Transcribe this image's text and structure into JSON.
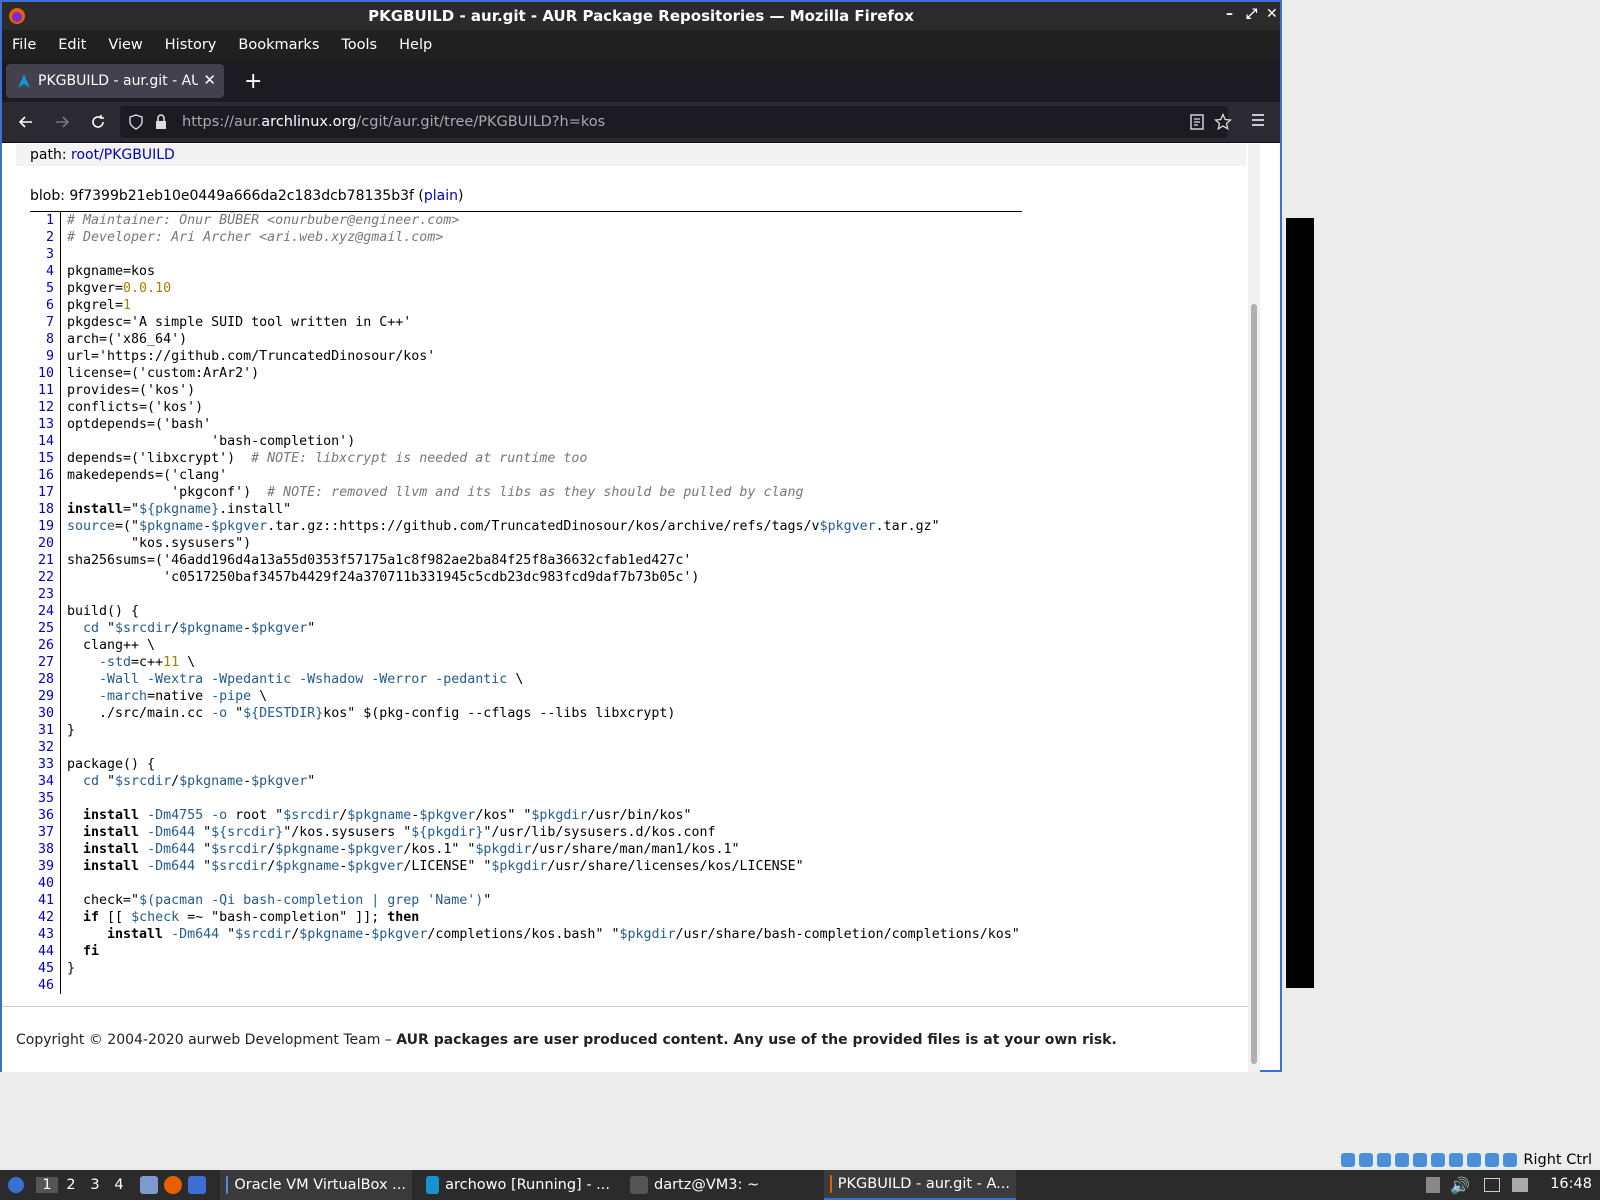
{
  "window": {
    "title": "PKGBUILD - aur.git - AUR Package Repositories — Mozilla Firefox",
    "controls": [
      "–",
      "⤢",
      "✕"
    ]
  },
  "menu": [
    "File",
    "Edit",
    "View",
    "History",
    "Bookmarks",
    "Tools",
    "Help"
  ],
  "tab": {
    "title": "PKGBUILD - aur.git - AUR",
    "close": "✕",
    "newtab": "+"
  },
  "url": {
    "prefix": "https://aur.",
    "domain": "archlinux.org",
    "suffix": "/cgit/aur.git/tree/PKGBUILD?h=kos"
  },
  "page": {
    "path_label": "path: ",
    "path_link": "root/PKGBUILD",
    "blob_label": "blob: 9f7399b21eb10e0449a666da2c183dcb78135b3f (",
    "blob_link": "plain",
    "blob_close": ")",
    "footer_normal": "Copyright © 2004-2020 aurweb Development Team – ",
    "footer_bold": "AUR packages are user produced content. Any use of the provided files is at your own risk."
  },
  "code": [
    [
      [
        "cm",
        "# Maintainer: Onur BÜBER <onurbuber@engineer.com>"
      ]
    ],
    [
      [
        "cm",
        "# Developer: Ari Archer <ari.web.xyz@gmail.com>"
      ]
    ],
    [],
    [
      [
        "",
        "pkgname=kos"
      ]
    ],
    [
      [
        "",
        "pkgver="
      ],
      [
        "nm",
        "0.0.10"
      ]
    ],
    [
      [
        "",
        "pkgrel="
      ],
      [
        "nm",
        "1"
      ]
    ],
    [
      [
        "",
        "pkgdesc='A simple SUID tool written in C++'"
      ]
    ],
    [
      [
        "",
        "arch=('x86_64')"
      ]
    ],
    [
      [
        "",
        "url='https://github.com/TruncatedDinosour/kos'"
      ]
    ],
    [
      [
        "",
        "license=('custom:ArAr2')"
      ]
    ],
    [
      [
        "",
        "provides=('kos')"
      ]
    ],
    [
      [
        "",
        "conflicts=('kos')"
      ]
    ],
    [
      [
        "",
        "optdepends=('bash'"
      ]
    ],
    [
      [
        "",
        "                  'bash-completion')"
      ]
    ],
    [
      [
        "",
        "depends=('libxcrypt')  "
      ],
      [
        "cm",
        "# NOTE: libxcrypt is needed at runtime too"
      ]
    ],
    [
      [
        "",
        "makedepends=('clang'"
      ]
    ],
    [
      [
        "",
        "             'pkgconf')  "
      ],
      [
        "cm",
        "# NOTE: removed llvm and its libs as they should be pulled by clang"
      ]
    ],
    [
      [
        "kw",
        "install"
      ],
      [
        "",
        "=\""
      ],
      [
        "vr",
        "${pkgname}"
      ],
      [
        "",
        ".install\""
      ]
    ],
    [
      [
        "vr",
        "source"
      ],
      [
        "",
        "=(\""
      ],
      [
        "vr",
        "$pkgname"
      ],
      [
        "",
        "-"
      ],
      [
        "vr",
        "$pkgver"
      ],
      [
        "",
        ".tar.gz::https://github.com/TruncatedDinosour/kos/archive/refs/tags/v"
      ],
      [
        "vr",
        "$pkgver"
      ],
      [
        "",
        ".tar.gz\""
      ]
    ],
    [
      [
        "",
        "        \"kos.sysusers\")"
      ]
    ],
    [
      [
        "",
        "sha256sums=('46add196d4a13a55d0353f57175a1c8f982ae2ba84f25f8a36632cfab1ed427c'"
      ]
    ],
    [
      [
        "",
        "            'c0517250baf3457b4429f24a370711b331945c5cdb23dc983fcd9daf7b73b05c')"
      ]
    ],
    [],
    [
      [
        "",
        "build() {"
      ]
    ],
    [
      [
        "vr",
        "  cd"
      ],
      [
        "",
        " \""
      ],
      [
        "vr",
        "$srcdir"
      ],
      [
        "",
        "/"
      ],
      [
        "vr",
        "$pkgname"
      ],
      [
        "",
        "-"
      ],
      [
        "vr",
        "$pkgver"
      ],
      [
        "",
        "\""
      ]
    ],
    [
      [
        "",
        "  clang++ \\"
      ]
    ],
    [
      [
        "vr",
        "    -std"
      ],
      [
        "",
        "=c++"
      ],
      [
        "nm",
        "11"
      ],
      [
        "",
        " \\"
      ]
    ],
    [
      [
        "vr",
        "    -Wall -Wextra -Wpedantic -Wshadow -Werror -pedantic"
      ],
      [
        "",
        " \\"
      ]
    ],
    [
      [
        "vr",
        "    -march"
      ],
      [
        "",
        "=native "
      ],
      [
        "vr",
        "-pipe"
      ],
      [
        "",
        " \\"
      ]
    ],
    [
      [
        "",
        "    ./src/main.cc "
      ],
      [
        "vr",
        "-o"
      ],
      [
        "",
        " \""
      ],
      [
        "vr",
        "${DESTDIR}"
      ],
      [
        "",
        "kos\" $(pkg-config --cflags --libs libxcrypt)"
      ]
    ],
    [
      [
        "",
        "}"
      ]
    ],
    [],
    [
      [
        "",
        "package() {"
      ]
    ],
    [
      [
        "vr",
        "  cd"
      ],
      [
        "",
        " \""
      ],
      [
        "vr",
        "$srcdir"
      ],
      [
        "",
        "/"
      ],
      [
        "vr",
        "$pkgname"
      ],
      [
        "",
        "-"
      ],
      [
        "vr",
        "$pkgver"
      ],
      [
        "",
        "\""
      ]
    ],
    [],
    [
      [
        "kw",
        "  install"
      ],
      [
        "",
        " "
      ],
      [
        "vr",
        "-Dm4755 -o"
      ],
      [
        "",
        " root \""
      ],
      [
        "vr",
        "$srcdir"
      ],
      [
        "",
        "/"
      ],
      [
        "vr",
        "$pkgname"
      ],
      [
        "",
        "-"
      ],
      [
        "vr",
        "$pkgver"
      ],
      [
        "",
        "/kos\" \""
      ],
      [
        "vr",
        "$pkgdir"
      ],
      [
        "",
        "/usr/bin/kos\""
      ]
    ],
    [
      [
        "kw",
        "  install"
      ],
      [
        "",
        " "
      ],
      [
        "vr",
        "-Dm644"
      ],
      [
        "",
        " \""
      ],
      [
        "vr",
        "${srcdir}"
      ],
      [
        "",
        "\"/kos.sysusers \""
      ],
      [
        "vr",
        "${pkgdir}"
      ],
      [
        "",
        "\"/usr/lib/sysusers.d/kos.conf"
      ]
    ],
    [
      [
        "kw",
        "  install"
      ],
      [
        "",
        " "
      ],
      [
        "vr",
        "-Dm644"
      ],
      [
        "",
        " \""
      ],
      [
        "vr",
        "$srcdir"
      ],
      [
        "",
        "/"
      ],
      [
        "vr",
        "$pkgname"
      ],
      [
        "",
        "-"
      ],
      [
        "vr",
        "$pkgver"
      ],
      [
        "",
        "/kos.1\" \""
      ],
      [
        "vr",
        "$pkgdir"
      ],
      [
        "",
        "/usr/share/man/man1/kos.1\""
      ]
    ],
    [
      [
        "kw",
        "  install"
      ],
      [
        "",
        " "
      ],
      [
        "vr",
        "-Dm644"
      ],
      [
        "",
        " \""
      ],
      [
        "vr",
        "$srcdir"
      ],
      [
        "",
        "/"
      ],
      [
        "vr",
        "$pkgname"
      ],
      [
        "",
        "-"
      ],
      [
        "vr",
        "$pkgver"
      ],
      [
        "",
        "/LICENSE\" \""
      ],
      [
        "vr",
        "$pkgdir"
      ],
      [
        "",
        "/usr/share/licenses/kos/LICENSE\""
      ]
    ],
    [],
    [
      [
        "",
        "  check=\""
      ],
      [
        "vr",
        "$(pacman -Qi bash-completion | grep 'Name')"
      ],
      [
        "",
        "\""
      ]
    ],
    [
      [
        "kw",
        "  if"
      ],
      [
        "",
        " [[ "
      ],
      [
        "vr",
        "$check"
      ],
      [
        "",
        " =~ \"bash-completion\" ]]; "
      ],
      [
        "kw",
        "then"
      ]
    ],
    [
      [
        "kw",
        "     install"
      ],
      [
        "",
        " "
      ],
      [
        "vr",
        "-Dm644"
      ],
      [
        "",
        " \""
      ],
      [
        "vr",
        "$srcdir"
      ],
      [
        "",
        "/"
      ],
      [
        "vr",
        "$pkgname"
      ],
      [
        "",
        "-"
      ],
      [
        "vr",
        "$pkgver"
      ],
      [
        "",
        "/completions/kos.bash\" \""
      ],
      [
        "vr",
        "$pkgdir"
      ],
      [
        "",
        "/usr/share/bash-completion/completions/kos\""
      ]
    ],
    [
      [
        "kw",
        "  fi"
      ]
    ],
    [
      [
        "",
        "}"
      ]
    ],
    []
  ],
  "tray": {
    "label": "Right Ctrl"
  },
  "taskbar": {
    "workspaces": [
      "1",
      "2",
      "3",
      "4"
    ],
    "tasks": [
      "Oracle VM VirtualBox ...",
      "archowo [Running] - ...",
      "dartz@VM3: ~",
      "PKGBUILD - aur.git - A..."
    ],
    "clock": "16:48"
  },
  "colors": {
    "accent": "#3b6fd4",
    "link": "#0000c0",
    "var": "#245c8f",
    "number": "#a08000"
  }
}
